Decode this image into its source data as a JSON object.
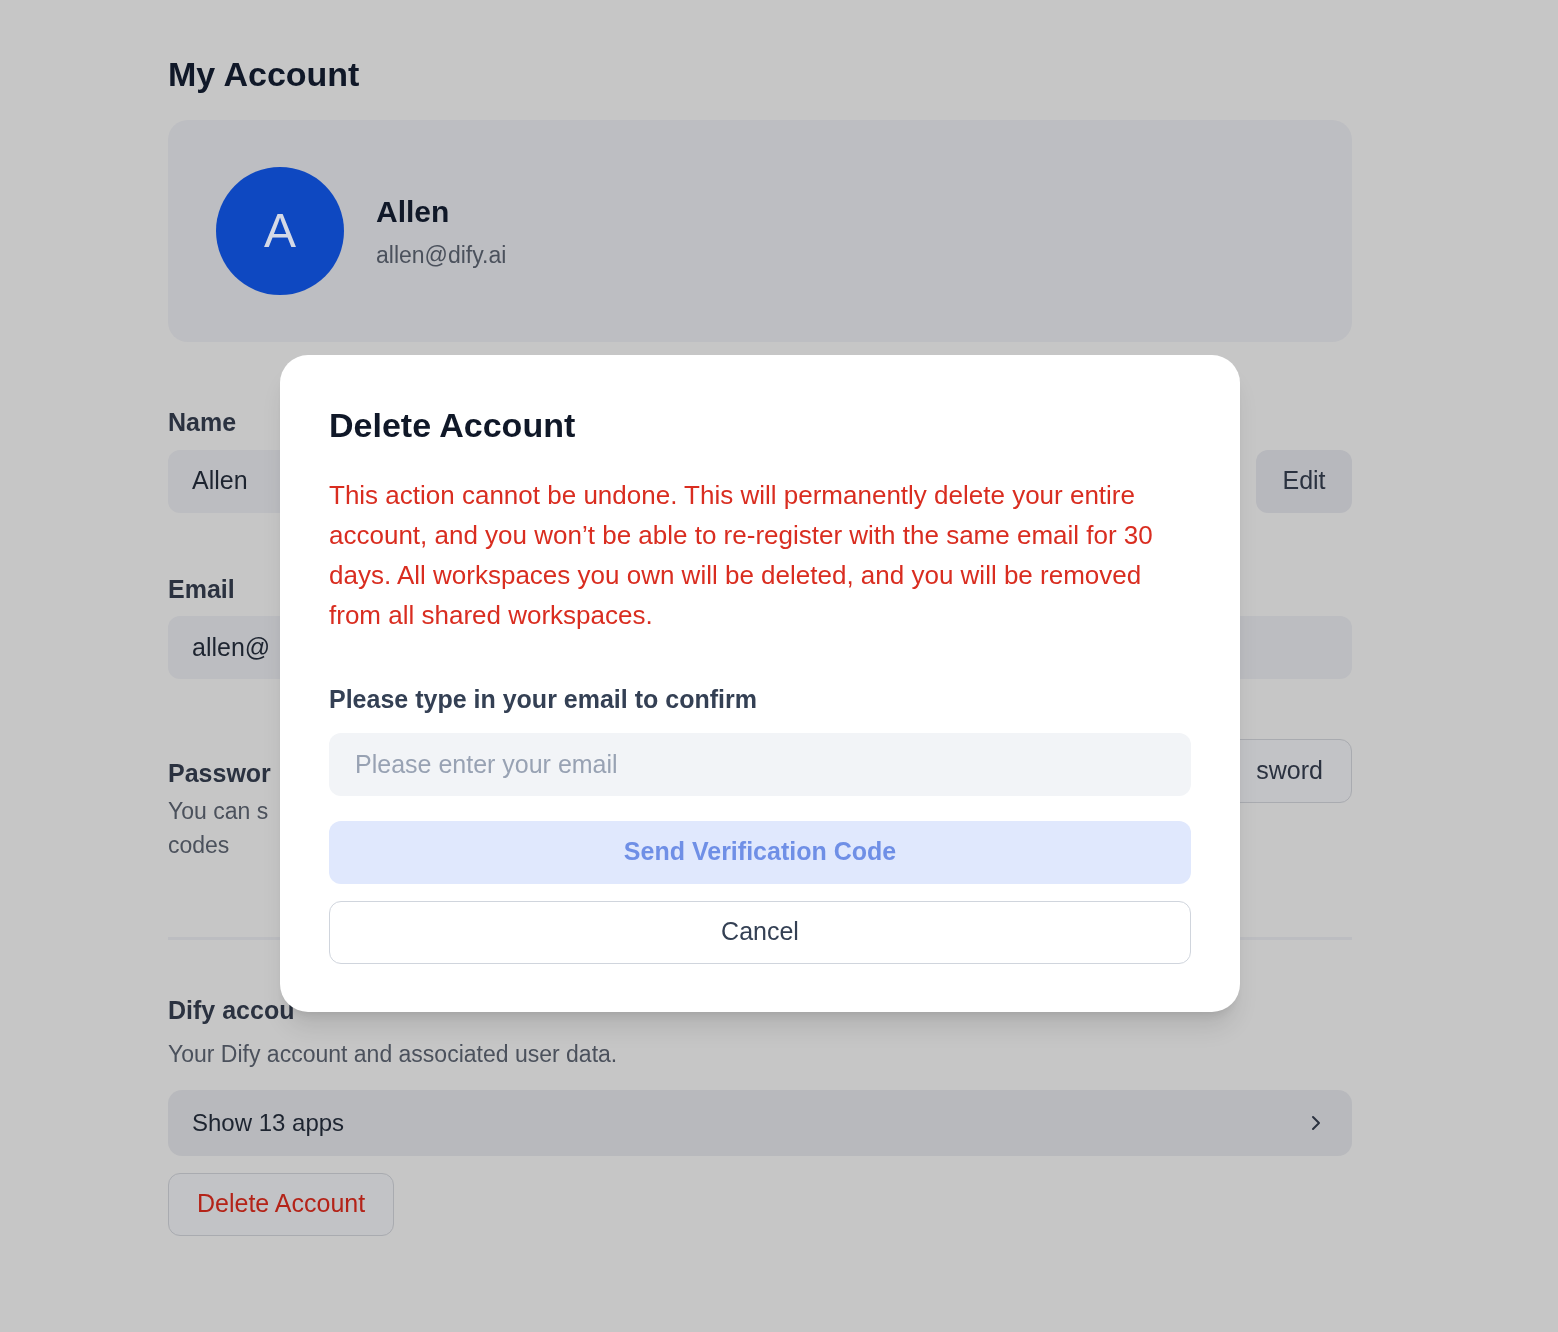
{
  "page": {
    "title": "My Account"
  },
  "profile": {
    "avatar_initial": "A",
    "name": "Allen",
    "email": "allen@dify.ai"
  },
  "name_field": {
    "label": "Name",
    "value": "Allen",
    "button": "Edit"
  },
  "email_field": {
    "label": "Email",
    "value": "allen@"
  },
  "password": {
    "label": "Passwor",
    "description_lines": [
      "You can s",
      "codes"
    ],
    "button": "sword"
  },
  "dify_account": {
    "title": "Dify accou",
    "description": "Your Dify account and associated user data.",
    "apps_link": "Show 13 apps",
    "delete_button": "Delete Account"
  },
  "dialog": {
    "title": "Delete Account",
    "warning": "This action cannot be undone. This will permanently delete your entire account, and you won’t be able to re-register with the same email for 30 days. All workspaces you own will be deleted, and you will be removed from all shared workspaces.",
    "confirm_label": "Please type in your email to confirm",
    "email_input": {
      "placeholder": "Please enter your email"
    },
    "send_button": {
      "label": "Send Verification Code",
      "disabled": true
    },
    "cancel_button": "Cancel"
  }
}
